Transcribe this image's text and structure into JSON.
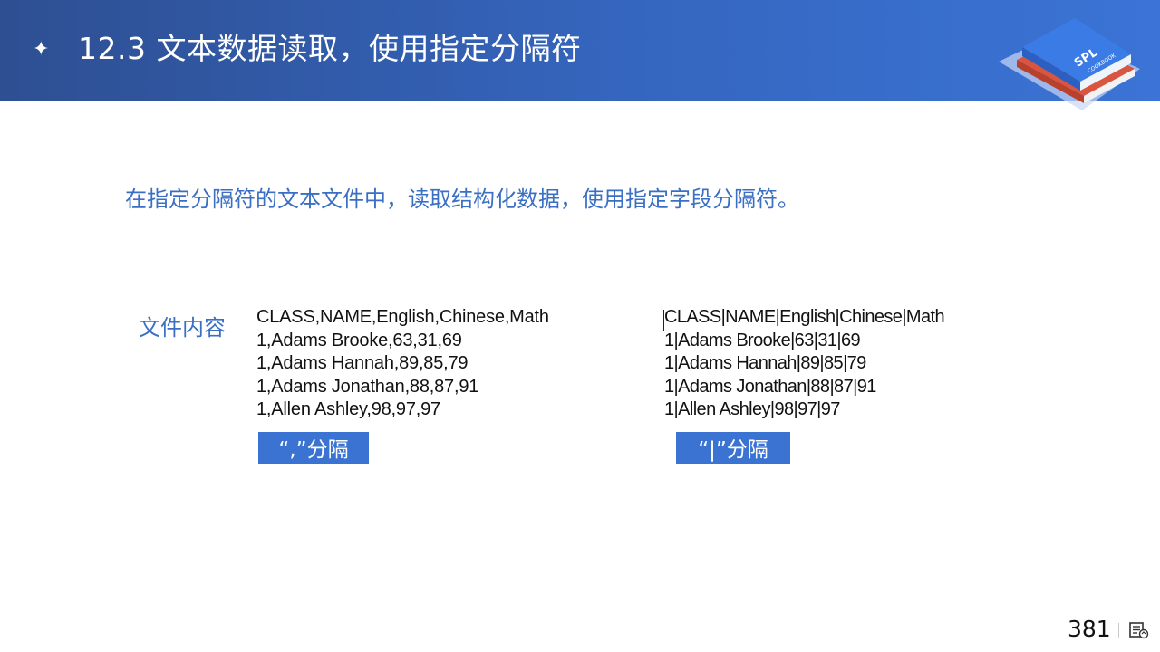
{
  "header": {
    "bullet_icon": "sparkle-icon",
    "title": "12.3 文本数据读取，使用指定分隔符",
    "logo_text": "SPL",
    "logo_subtext": "COOKBOOK"
  },
  "subtitle": "在指定分隔符的文本文件中，读取结构化数据，使用指定字段分隔符。",
  "content_label": "文件内容",
  "comma_file": {
    "lines": [
      "CLASS,NAME,English,Chinese,Math",
      "1,Adams Brooke,63,31,69",
      "1,Adams Hannah,89,85,79",
      "1,Adams Jonathan,88,87,91",
      "1,Allen Ashley,98,97,97"
    ],
    "tag": "“,”分隔"
  },
  "pipe_file": {
    "lines": [
      "CLASS|NAME|English|Chinese|Math",
      "1|Adams Brooke|63|31|69",
      "1|Adams Hannah|89|85|79",
      "1|Adams Jonathan|88|87|91",
      "1|Allen Ashley|98|97|97"
    ],
    "tag": "“|”分隔"
  },
  "footer": {
    "page_number": "381",
    "notes_icon": "notes-view-icon"
  },
  "colors": {
    "header_start": "#2e4f92",
    "header_end": "#3b74d6",
    "accent_text": "#3a6fc4",
    "tag_bg": "#3b73d2"
  }
}
